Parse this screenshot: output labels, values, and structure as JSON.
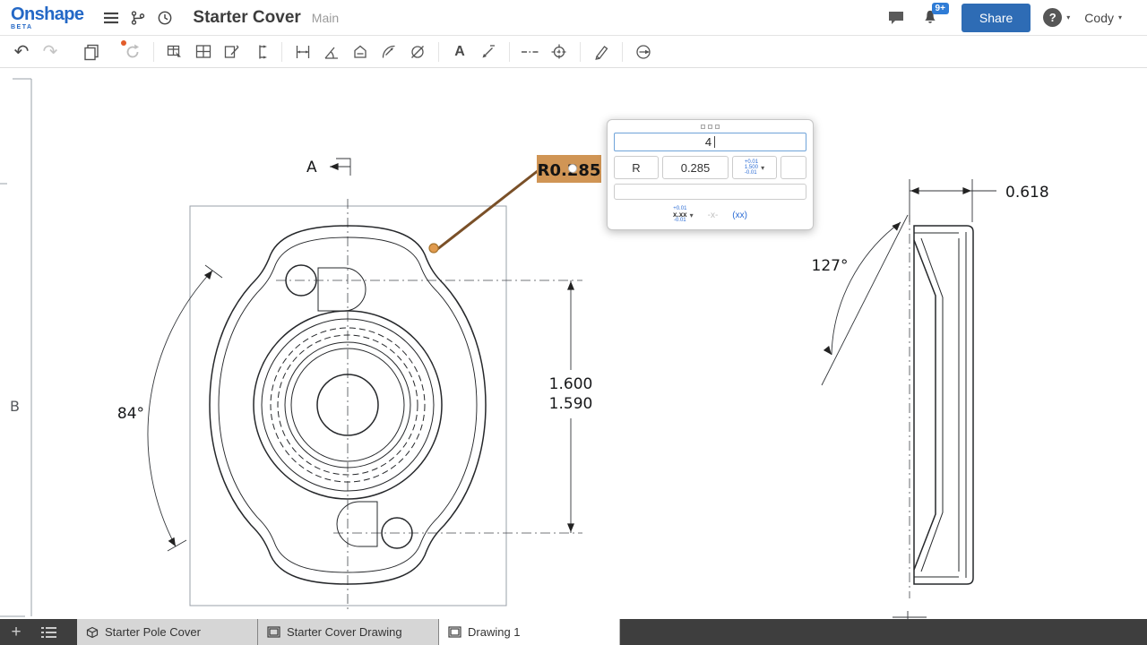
{
  "app": {
    "logo": "Onshape",
    "beta": "BETA",
    "title": "Starter Cover",
    "branch": "Main",
    "notification_count": "9+",
    "share_label": "Share",
    "help_label": "?",
    "user": "Cody"
  },
  "icons": {
    "undo": "↶",
    "redo": "↷",
    "caret_down": "▾",
    "plus": "+",
    "note": "A"
  },
  "drawing": {
    "zone_label": "B",
    "section_label": "A",
    "dims": {
      "angle_left": "84°",
      "radius": "R0.285",
      "vertical_upper": "1.600",
      "vertical_lower": "1.590",
      "width": "0.618",
      "angle_right": "127°"
    }
  },
  "popup": {
    "value": "4",
    "prefix": "R",
    "dimension": "0.285",
    "tolerance": {
      "upper": "+0.01",
      "value": "1.500",
      "lower": "-0.01"
    },
    "format": {
      "precision": "x.xx",
      "upper": "+0.01",
      "lower": "-0.01",
      "dash": "-x-",
      "dual": "(xx)"
    }
  },
  "tabs": [
    {
      "label": "Starter Pole Cover"
    },
    {
      "label": "Starter Cover Drawing"
    },
    {
      "label": "Drawing 1"
    }
  ]
}
